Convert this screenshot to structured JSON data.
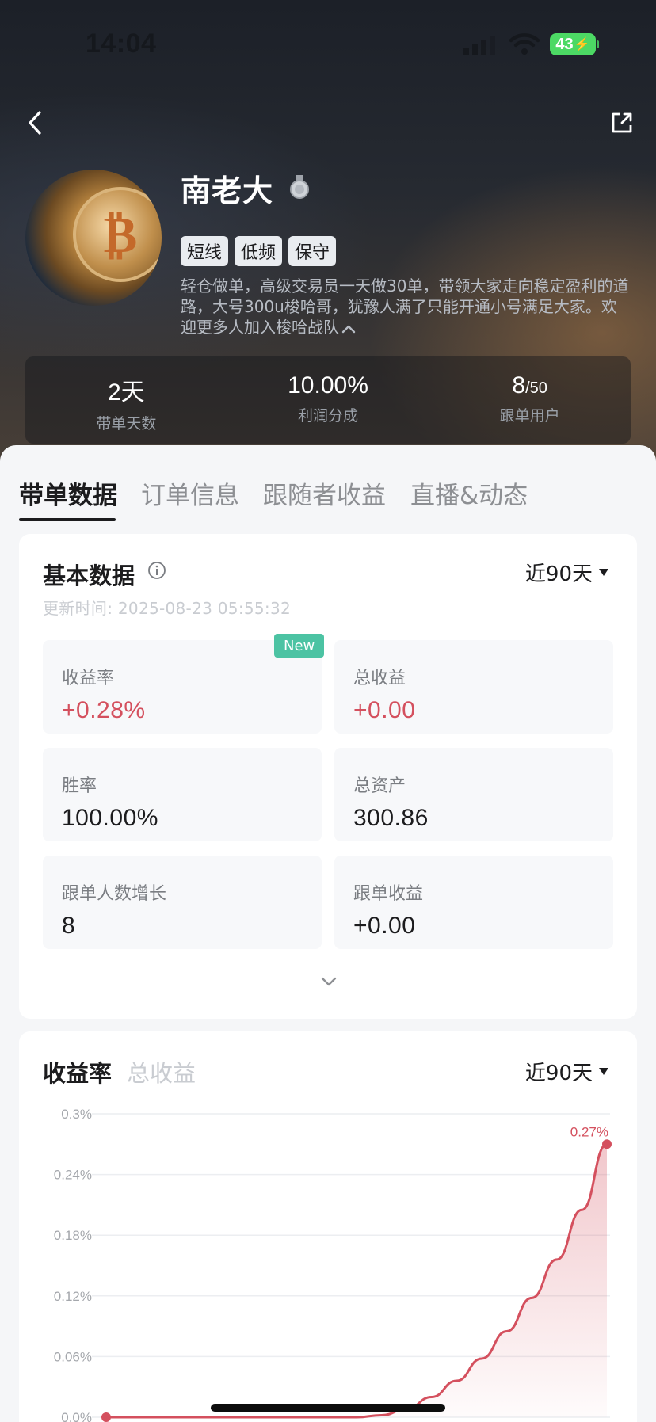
{
  "status_bar": {
    "time": "14:04",
    "battery": "43"
  },
  "header": {
    "back_icon": "chevron-left-icon",
    "share_icon": "share-external-icon",
    "name": "南老大",
    "medal_icon": "silver-medal-icon",
    "tags": [
      "短线",
      "低频",
      "保守"
    ],
    "bio": "轻仓做单，高级交易员一天做30单，带领大家走向稳定盈利的道路，大号300u梭哈哥，犹豫人满了只能开通小号满足大家。欢迎更多人加入梭哈战队"
  },
  "stats": [
    {
      "value": "2天",
      "suffix": "",
      "label": "带单天数"
    },
    {
      "value": "10.00%",
      "suffix": "",
      "label": "利润分成"
    },
    {
      "value": "8",
      "suffix": "/50",
      "label": "跟单用户"
    }
  ],
  "tabs": [
    "带单数据",
    "订单信息",
    "跟随者收益",
    "直播&动态"
  ],
  "basic_data": {
    "title": "基本数据",
    "update_time": "更新时间: 2025-08-23 05:55:32",
    "range": "近90天",
    "new_badge": "New",
    "metrics": [
      {
        "label": "收益率",
        "value": "+0.28%"
      },
      {
        "label": "总收益",
        "value": "+0.00"
      },
      {
        "label": "胜率",
        "value": "100.00%"
      },
      {
        "label": "总资产",
        "value": "300.86"
      },
      {
        "label": "跟单人数增长",
        "value": "8"
      },
      {
        "label": "跟单收益",
        "value": "+0.00"
      }
    ]
  },
  "chart_card": {
    "tab_active": "收益率",
    "tab_inactive": "总收益",
    "range": "近90天"
  },
  "colors": {
    "accent_red": "#d4505e",
    "badge_green": "#4cc3a3"
  },
  "chart_data": {
    "type": "area",
    "y_ticks": [
      "0.3%",
      "0.24%",
      "0.18%",
      "0.12%",
      "0.06%",
      "0.0%"
    ],
    "ylim": [
      0,
      0.3
    ],
    "x": [
      0,
      0.1,
      0.2,
      0.3,
      0.4,
      0.5,
      0.55,
      0.6,
      0.65,
      0.7,
      0.75,
      0.8,
      0.85,
      0.9,
      0.95,
      1.0
    ],
    "values": [
      0,
      0,
      0,
      0,
      0,
      0,
      0.002,
      0.008,
      0.02,
      0.036,
      0.058,
      0.085,
      0.118,
      0.156,
      0.205,
      0.27
    ],
    "end_label": "0.27%",
    "grid": true,
    "series": [
      {
        "values_ref": "values",
        "color": "#d4505e"
      }
    ]
  }
}
